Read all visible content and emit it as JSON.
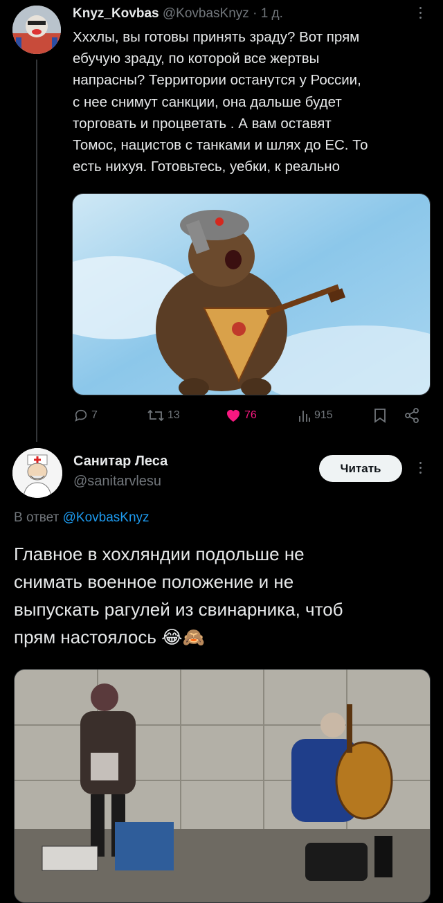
{
  "tweet1": {
    "display_name": "Knyz_Kovbas",
    "handle": "@KovbasKnyz",
    "separator": "·",
    "time": "1 д.",
    "text": "Хххлы, вы готовы принять зраду? Вот прям\nебучую зраду, по которой все жертвы\nнапрасны? Территории останутся у России,\nс нее снимут санкции, она дальше будет\nторговать и процветать . А вам оставят\nТомос, нацистов с танками и шлях до ЕС. То\nесть нихуя. Готовьтесь, уебки, к реально",
    "image_icon": "bear-balalaika-illustration",
    "actions": {
      "replies": "7",
      "retweets": "13",
      "likes": "76",
      "views": "915"
    },
    "like_color": "#f91880"
  },
  "tweet2": {
    "display_name": "Санитар Леса",
    "handle": "@sanitarvlesu",
    "follow_label": "Читать",
    "reply_prefix": "В ответ",
    "reply_to": "@KovbasKnyz",
    "text": "Главное в хохляндии подольше не\nснимать военное положение и не\nвыпускать рагулей из свинарника, чтоб\nпрям настоялось 😂🙈",
    "image_icon": "street-photo-bandura-player"
  },
  "colors": {
    "accent": "#1d9bf0",
    "background": "#000000",
    "text": "#e7e9ea",
    "muted": "#71767b"
  }
}
